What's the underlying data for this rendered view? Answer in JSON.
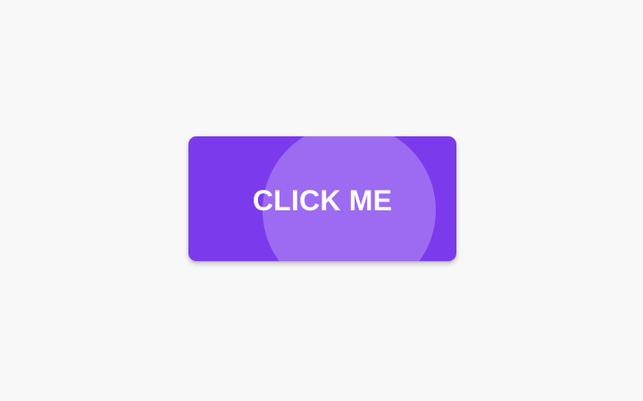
{
  "button": {
    "label": "CLICK ME",
    "color": "#7c3aed",
    "ripple_color": "rgba(255,255,255,0.25)"
  },
  "page": {
    "background": "#f8f8f8"
  }
}
